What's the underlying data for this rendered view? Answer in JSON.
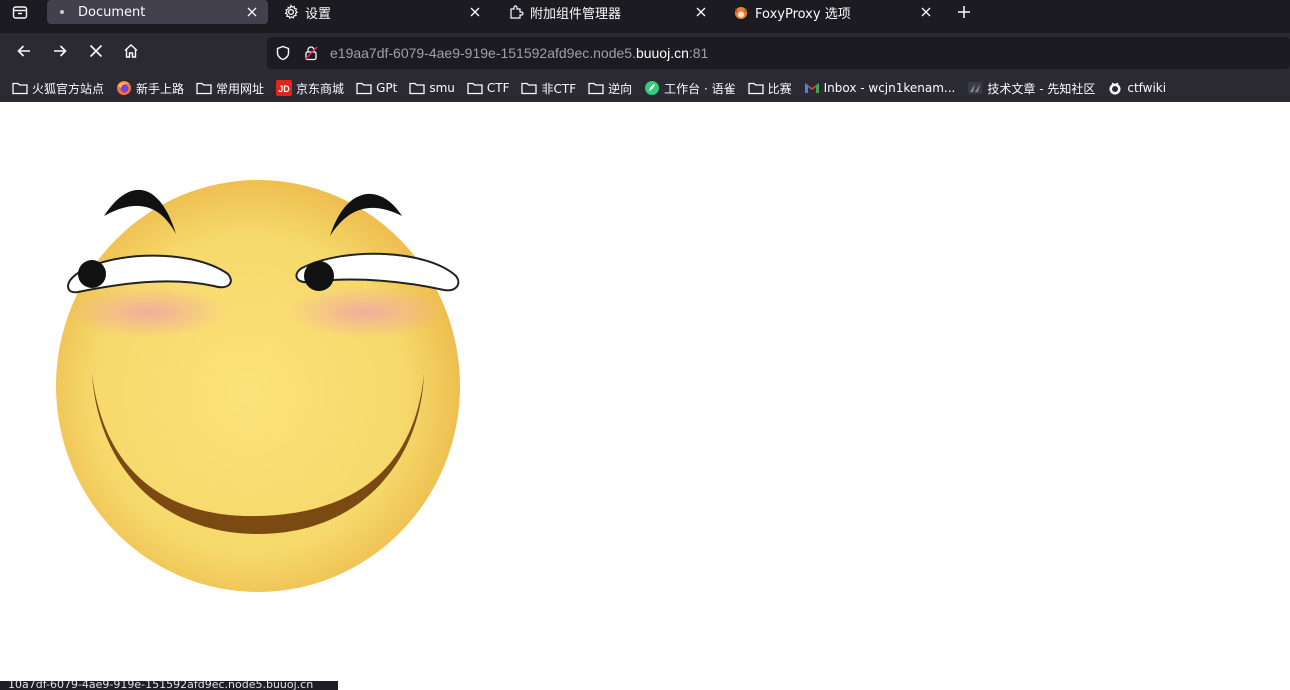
{
  "tabs": [
    {
      "label": "Document",
      "icon": "dot-icon",
      "active": true
    },
    {
      "label": "设置",
      "icon": "gear-icon",
      "active": false
    },
    {
      "label": "附加组件管理器",
      "icon": "puzzle-icon",
      "active": false
    },
    {
      "label": "FoxyProxy 选项",
      "icon": "fox-icon",
      "active": false
    }
  ],
  "url": {
    "prefix": "e19aa7df-6079-4ae9-919e-151592afd9ec.node5.",
    "domain": "buuoj.cn",
    "suffix": ":81"
  },
  "bookmarks": [
    {
      "label": "火狐官方站点",
      "icon": "folder-icon"
    },
    {
      "label": "新手上路",
      "icon": "firefox-icon"
    },
    {
      "label": "常用网址",
      "icon": "folder-icon"
    },
    {
      "label": "京东商城",
      "icon": "jd-icon"
    },
    {
      "label": "GPt",
      "icon": "folder-icon"
    },
    {
      "label": "smu",
      "icon": "folder-icon"
    },
    {
      "label": "CTF",
      "icon": "folder-icon"
    },
    {
      "label": "非CTF",
      "icon": "folder-icon"
    },
    {
      "label": "逆向",
      "icon": "folder-icon"
    },
    {
      "label": "工作台 · 语雀",
      "icon": "yuque-icon"
    },
    {
      "label": "比赛",
      "icon": "folder-icon"
    },
    {
      "label": "Inbox - wcjn1kenam...",
      "icon": "gmail-icon"
    },
    {
      "label": "技术文章 - 先知社区",
      "icon": "xianzhi-icon"
    },
    {
      "label": "ctfwiki",
      "icon": "ctfwiki-icon"
    }
  ],
  "status": {
    "text": "10a7df-6079-4ae9-919e-151592afd9ec.node5.buuoj.cn"
  },
  "colors": {
    "face": "#f6d96b",
    "blush": "#f2a8a0",
    "brow": "#111111",
    "mouth": "#7a4a12"
  }
}
